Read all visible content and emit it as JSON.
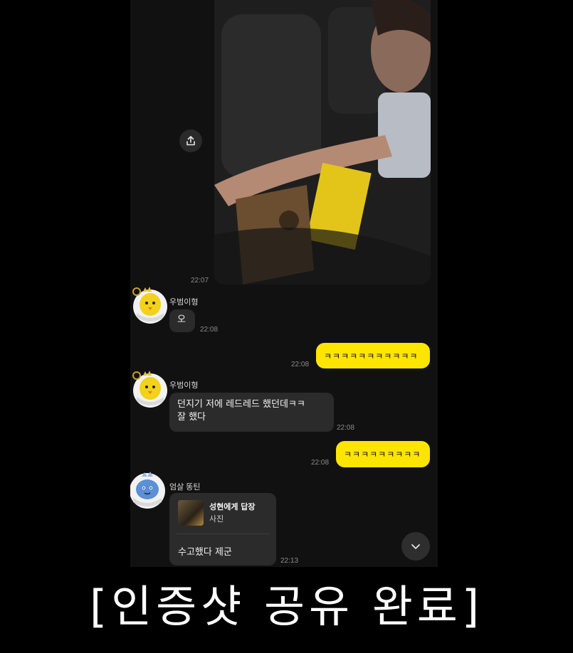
{
  "chat": {
    "photo_time": "22:07",
    "messages": [
      {
        "sender": "우범이형",
        "text": "오",
        "time": "22:08"
      },
      {
        "mine": true,
        "text": "ㅋㅋㅋㅋㅋㅋㅋㅋㅋㅋㅋ",
        "time": "22:08"
      },
      {
        "sender": "우범이형",
        "line1": "던지기 저에 레드레드 했던데ㅋㅋ",
        "line2": "잘 했다",
        "time": "22:08"
      },
      {
        "mine": true,
        "text": "ㅋㅋㅋㅋㅋㅋㅋㅋㅋ",
        "time": "22:08"
      },
      {
        "sender": "엄살 똥틴",
        "reply_title": "성현에게 답장",
        "reply_sub": "사진",
        "text": "수고했다 제군",
        "time": "22:13"
      }
    ]
  },
  "caption": "[인증샷 공유 완료]",
  "colors": {
    "my_bubble": "#fee500",
    "other_bubble": "#2b2b2b",
    "background": "#111111"
  },
  "icons": {
    "share": "share-icon",
    "scroll": "chevron-down-icon"
  }
}
